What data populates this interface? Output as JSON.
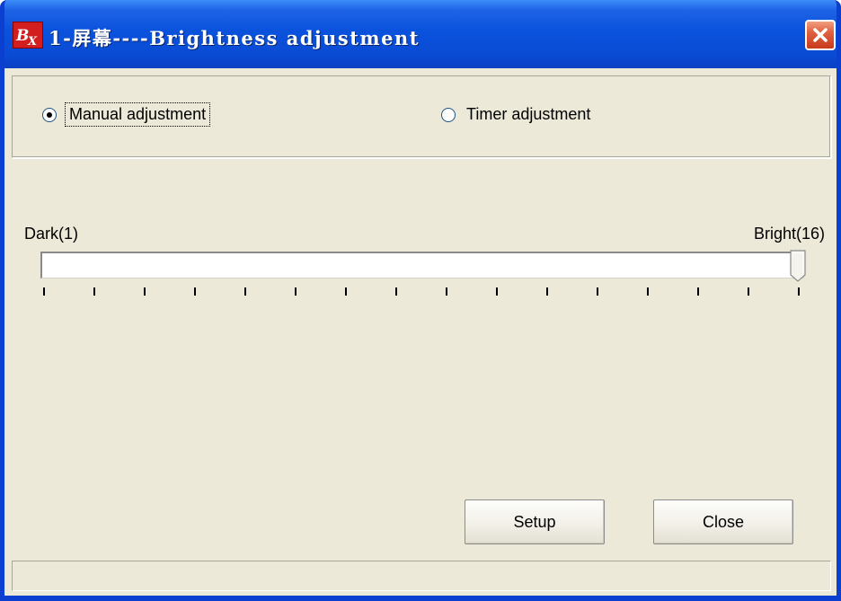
{
  "window": {
    "title": "1-屏幕----Brightness adjustment",
    "icon": "bx-app-icon"
  },
  "mode": {
    "options": [
      {
        "label": "Manual adjustment",
        "selected": true
      },
      {
        "label": "Timer adjustment",
        "selected": false
      }
    ]
  },
  "slider": {
    "min_label": "Dark(1)",
    "max_label": "Bright(16)",
    "min": 1,
    "max": 16,
    "value": 16
  },
  "buttons": {
    "setup_label": "Setup",
    "close_label": "Close"
  },
  "statusbar": {
    "text": ""
  },
  "colors": {
    "titlebar": "#0a52dc",
    "face": "#ece9d8",
    "close": "#e06040",
    "icon_red": "#d21e1e"
  }
}
